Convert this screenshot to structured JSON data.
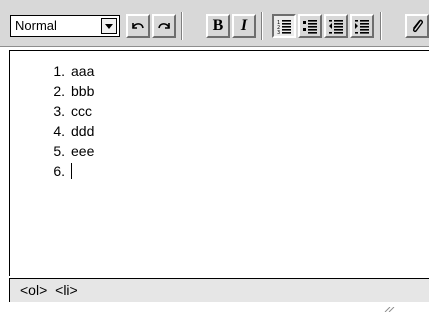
{
  "toolbar": {
    "format_select": {
      "selected": "Normal"
    },
    "buttons": [
      {
        "name": "undo",
        "icon": "undo-icon"
      },
      {
        "name": "redo",
        "icon": "redo-icon"
      },
      {
        "name": "bold",
        "label": "B"
      },
      {
        "name": "italic",
        "label": "I"
      },
      {
        "name": "ordered-list",
        "icon": "ordered-list-icon",
        "active": true
      },
      {
        "name": "unordered-list",
        "icon": "bullet-list-icon"
      },
      {
        "name": "outdent",
        "icon": "outdent-icon"
      },
      {
        "name": "indent",
        "icon": "indent-icon"
      },
      {
        "name": "attach",
        "icon": "paperclip-icon"
      }
    ]
  },
  "editor": {
    "list": [
      {
        "number": "1.",
        "text": "aaa"
      },
      {
        "number": "2.",
        "text": "bbb"
      },
      {
        "number": "3.",
        "text": "ccc"
      },
      {
        "number": "4.",
        "text": "ddd"
      },
      {
        "number": "5.",
        "text": "eee"
      },
      {
        "number": "6.",
        "text": ""
      }
    ]
  },
  "status_bar": {
    "path": [
      "<ol>",
      "<li>"
    ]
  },
  "colors": {
    "toolbar_bg": "#d8d8d8",
    "active_button_bg": "#ececec",
    "status_bg": "#e6e6e6",
    "text": "#000000"
  }
}
